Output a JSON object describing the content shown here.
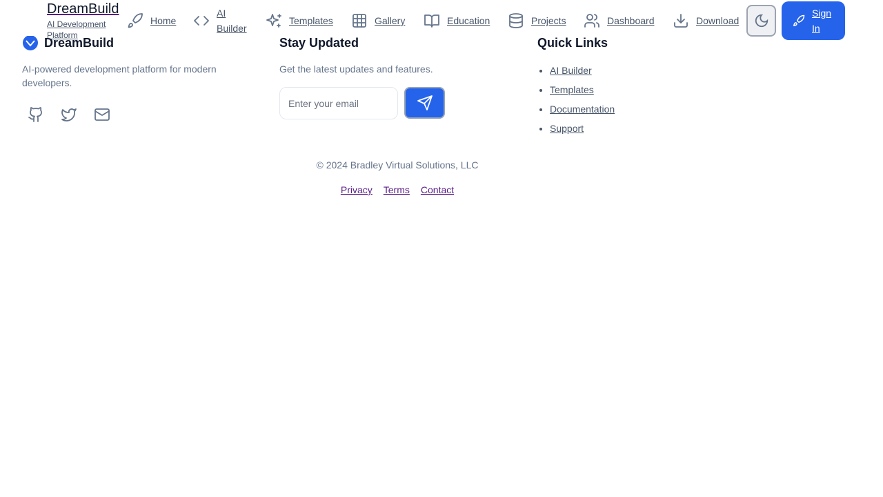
{
  "header": {
    "brand": "DreamBuild",
    "tagline": "AI Development Platform",
    "nav": [
      {
        "label": "Home",
        "icon": "rocket-icon"
      },
      {
        "label": "AI Builder",
        "icon": "code-icon"
      },
      {
        "label": "Templates",
        "icon": "sparkles-icon"
      },
      {
        "label": "Gallery",
        "icon": "grid-icon"
      },
      {
        "label": "Education",
        "icon": "book-icon"
      },
      {
        "label": "Projects",
        "icon": "database-icon"
      },
      {
        "label": "Dashboard",
        "icon": "users-icon"
      },
      {
        "label": "Download",
        "icon": "download-icon"
      }
    ],
    "sign_in": "Sign In"
  },
  "footer": {
    "brand": "DreamBuild",
    "description": "AI-powered development platform for modern developers.",
    "newsletter": {
      "title": "Stay Updated",
      "text": "Get the latest updates and features.",
      "placeholder": "Enter your email"
    },
    "quick_links": {
      "title": "Quick Links",
      "items": [
        "AI Builder",
        "Templates",
        "Documentation",
        "Support"
      ]
    },
    "copyright": "© 2024 Bradley Virtual Solutions, LLC",
    "legal": [
      "Privacy",
      "Terms",
      "Contact"
    ]
  },
  "colors": {
    "accent": "#2563eb",
    "text": "#0f172a",
    "muted": "#64748b"
  }
}
